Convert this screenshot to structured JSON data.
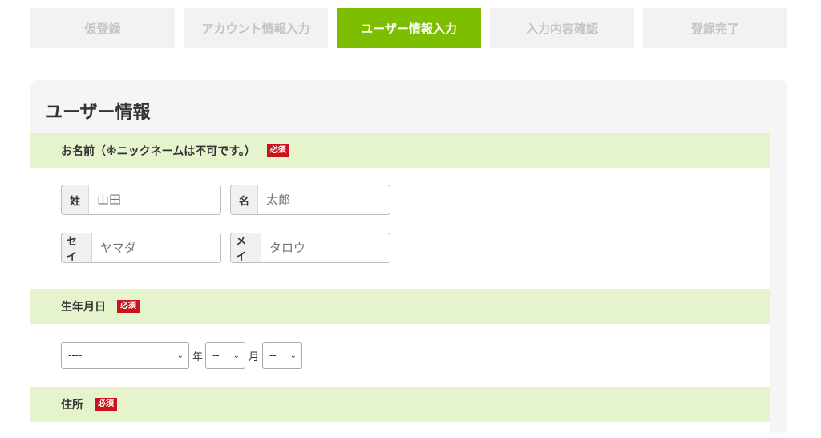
{
  "steps": [
    {
      "label": "仮登録",
      "active": false
    },
    {
      "label": "アカウント情報入力",
      "active": false
    },
    {
      "label": "ユーザー情報入力",
      "active": true
    },
    {
      "label": "入力内容確認",
      "active": false
    },
    {
      "label": "登録完了",
      "active": false
    }
  ],
  "panel": {
    "title": "ユーザー情報"
  },
  "required_label": "必須",
  "name_section": {
    "header": "お名前（※ニックネームは不可です。）",
    "last_name": {
      "label": "姓",
      "value": "",
      "placeholder": "山田"
    },
    "first_name": {
      "label": "名",
      "value": "",
      "placeholder": "太郎"
    },
    "last_name_kana": {
      "label": "セイ",
      "value": "",
      "placeholder": "ヤマダ"
    },
    "first_name_kana": {
      "label": "メイ",
      "value": "",
      "placeholder": "タロウ"
    }
  },
  "birth_section": {
    "header": "生年月日",
    "year": {
      "value": "----",
      "unit": "年"
    },
    "month": {
      "value": "--",
      "unit": "月"
    },
    "day": {
      "value": "--"
    }
  },
  "address_section": {
    "header": "住所"
  },
  "colors": {
    "accent": "#7dbe00",
    "required": "#c8141e",
    "section_bg": "#e6f4ce"
  },
  "icons": {
    "select_caret": "chevron-down-icon"
  }
}
